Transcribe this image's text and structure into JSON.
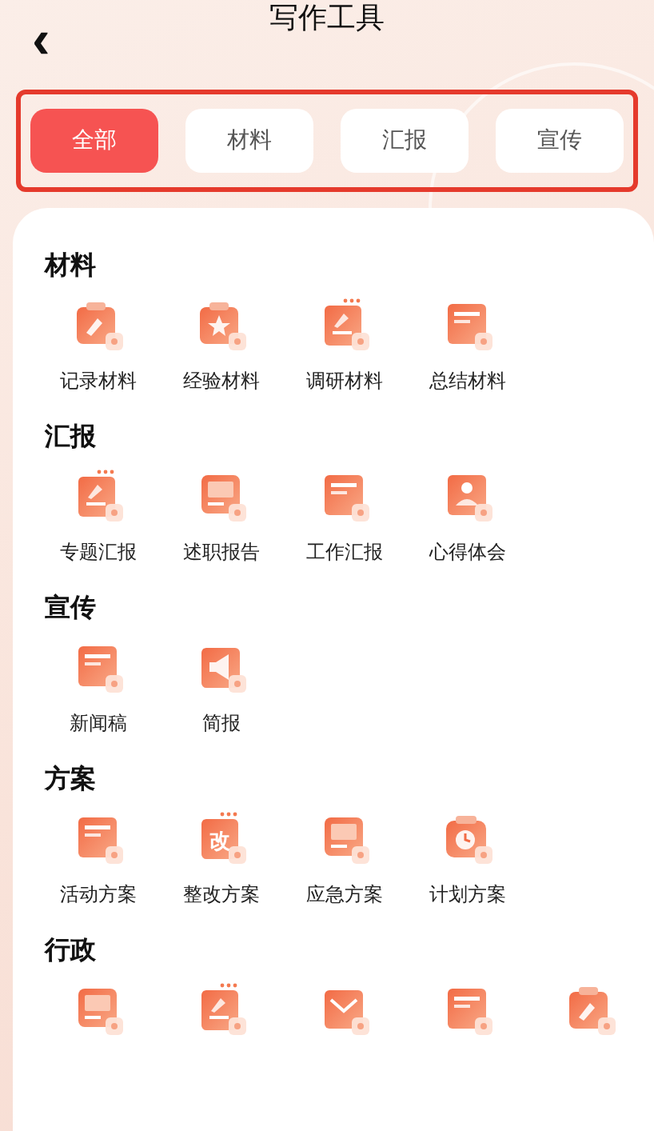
{
  "header": {
    "back": "‹",
    "title": "写作工具"
  },
  "tabs": [
    {
      "label": "全部",
      "selected": true
    },
    {
      "label": "材料",
      "selected": false
    },
    {
      "label": "汇报",
      "selected": false
    },
    {
      "label": "宣传",
      "selected": false
    }
  ],
  "sections": [
    {
      "title": "材料",
      "items": [
        {
          "label": "记录材料",
          "kind": "clipboard"
        },
        {
          "label": "经验材料",
          "kind": "clipboard-star"
        },
        {
          "label": "调研材料",
          "kind": "document"
        },
        {
          "label": "总结材料",
          "kind": "card"
        }
      ]
    },
    {
      "title": "汇报",
      "items": [
        {
          "label": "专题汇报",
          "kind": "document"
        },
        {
          "label": "述职报告",
          "kind": "screen"
        },
        {
          "label": "工作汇报",
          "kind": "card"
        },
        {
          "label": "心得体会",
          "kind": "person"
        }
      ]
    },
    {
      "title": "宣传",
      "items": [
        {
          "label": "新闻稿",
          "kind": "card"
        },
        {
          "label": "简报",
          "kind": "megaphone"
        }
      ]
    },
    {
      "title": "方案",
      "items": [
        {
          "label": "活动方案",
          "kind": "card"
        },
        {
          "label": "整改方案",
          "kind": "glyph",
          "glyph": "改"
        },
        {
          "label": "应急方案",
          "kind": "screen"
        },
        {
          "label": "计划方案",
          "kind": "clock"
        }
      ]
    },
    {
      "title": "行政",
      "items": [
        {
          "kind": "screen"
        },
        {
          "kind": "document"
        },
        {
          "kind": "mail"
        },
        {
          "kind": "card"
        },
        {
          "kind": "clipboard"
        }
      ]
    }
  ]
}
